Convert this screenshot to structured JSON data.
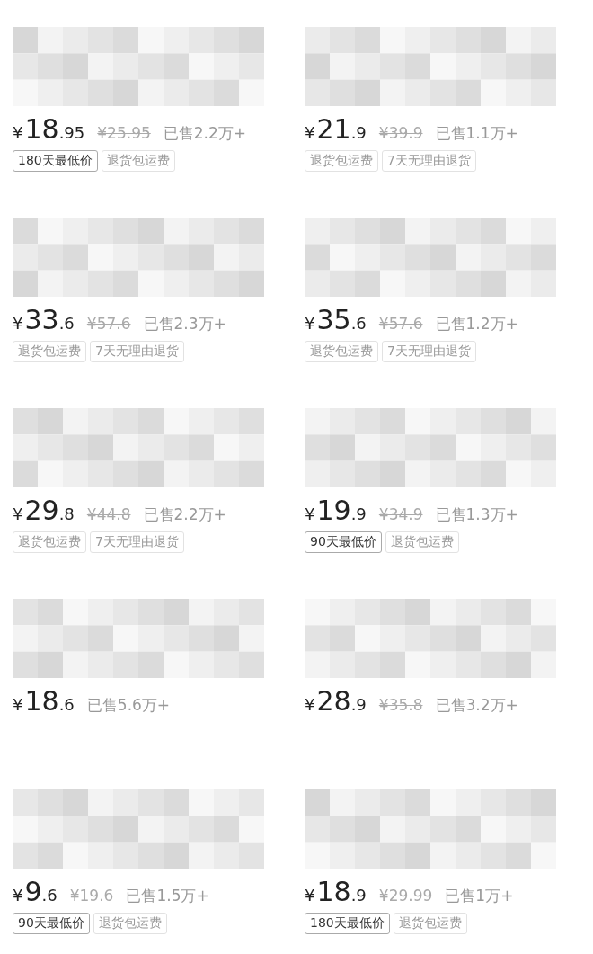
{
  "products": [
    {
      "currency": "¥",
      "price_int": "18",
      "price_dec": ".95",
      "original_price": "¥25.95",
      "sold": "已售2.2万+",
      "tags": [
        {
          "kind": "lowest_price",
          "label": "180天最低价"
        },
        {
          "kind": "service",
          "label": "退货包运费"
        }
      ]
    },
    {
      "currency": "¥",
      "price_int": "21",
      "price_dec": ".9",
      "original_price": "¥39.9",
      "sold": "已售1.1万+",
      "tags": [
        {
          "kind": "service",
          "label": "退货包运费"
        },
        {
          "kind": "service",
          "label": "7天无理由退货"
        }
      ]
    },
    {
      "currency": "¥",
      "price_int": "33",
      "price_dec": ".6",
      "original_price": "¥57.6",
      "sold": "已售2.3万+",
      "tags": [
        {
          "kind": "service",
          "label": "退货包运费"
        },
        {
          "kind": "service",
          "label": "7天无理由退货"
        }
      ]
    },
    {
      "currency": "¥",
      "price_int": "35",
      "price_dec": ".6",
      "original_price": "¥57.6",
      "sold": "已售1.2万+",
      "tags": [
        {
          "kind": "service",
          "label": "退货包运费"
        },
        {
          "kind": "service",
          "label": "7天无理由退货"
        }
      ]
    },
    {
      "currency": "¥",
      "price_int": "29",
      "price_dec": ".8",
      "original_price": "¥44.8",
      "sold": "已售2.2万+",
      "tags": [
        {
          "kind": "service",
          "label": "退货包运费"
        },
        {
          "kind": "service",
          "label": "7天无理由退货"
        }
      ]
    },
    {
      "currency": "¥",
      "price_int": "19",
      "price_dec": ".9",
      "original_price": "¥34.9",
      "sold": "已售1.3万+",
      "tags": [
        {
          "kind": "lowest_price",
          "label": "90天最低价"
        },
        {
          "kind": "service",
          "label": "退货包运费"
        }
      ]
    },
    {
      "currency": "¥",
      "price_int": "18",
      "price_dec": ".6",
      "sold": "已售5.6万+"
    },
    {
      "currency": "¥",
      "price_int": "28",
      "price_dec": ".9",
      "original_price": "¥35.8",
      "sold": "已售3.2万+"
    },
    {
      "currency": "¥",
      "price_int": "9",
      "price_dec": ".6",
      "original_price": "¥19.6",
      "sold": "已售1.5万+",
      "tags": [
        {
          "kind": "lowest_price",
          "label": "90天最低价"
        },
        {
          "kind": "service",
          "label": "退货包运费"
        }
      ]
    },
    {
      "currency": "¥",
      "price_int": "18",
      "price_dec": ".9",
      "original_price": "¥29.99",
      "sold": "已售1万+",
      "tags": [
        {
          "kind": "lowest_price",
          "label": "180天最低价"
        },
        {
          "kind": "service",
          "label": "退货包运费"
        }
      ]
    }
  ]
}
